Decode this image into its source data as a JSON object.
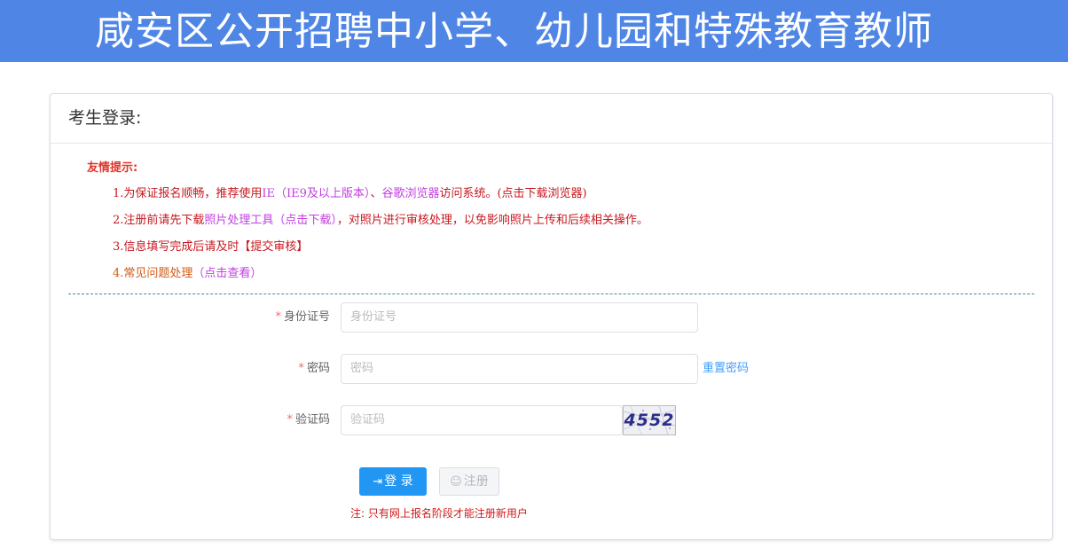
{
  "banner": {
    "title": "咸安区公开招聘中小学、幼儿园和特殊教育教师",
    "background": "#4f86e6"
  },
  "panel": {
    "title": "考生登录:"
  },
  "tips": {
    "title": "友情提示:",
    "items": [
      {
        "prefix": "1.为保证报名顺畅，推荐使用",
        "link1": "IE（IE9及以上版本）",
        "middle": "、",
        "link2": "谷歌浏览器",
        "suffix": "访问系统。(点击下载浏览器)"
      },
      {
        "prefix": "2.注册前请先下载",
        "link1": "照片处理工具（点击下载）",
        "suffix": "，对照片进行审核处理，以免影响照片上传和后续相关操作。"
      },
      {
        "text": "3.信息填写完成后请及时【提交审核】"
      },
      {
        "prefix": "4.常见问题处理",
        "link1": "（点击查看）"
      }
    ]
  },
  "form": {
    "id_label": "身份证号",
    "id_placeholder": "身份证号",
    "password_label": "密码",
    "password_placeholder": "密码",
    "reset_password": "重置密码",
    "captcha_label": "验证码",
    "captcha_placeholder": "验证码",
    "captcha_text": "4552",
    "required_mark": "*"
  },
  "buttons": {
    "login": "登 录",
    "login_icon": "sign-in-icon",
    "register": "注册",
    "register_icon": "user-icon"
  },
  "note": "注: 只有网上报名阶段才能注册新用户",
  "colors": {
    "accent": "#2196f3",
    "link": "#409eff",
    "tip_red": "#c8171f",
    "tip_purple": "#c23ee0"
  }
}
